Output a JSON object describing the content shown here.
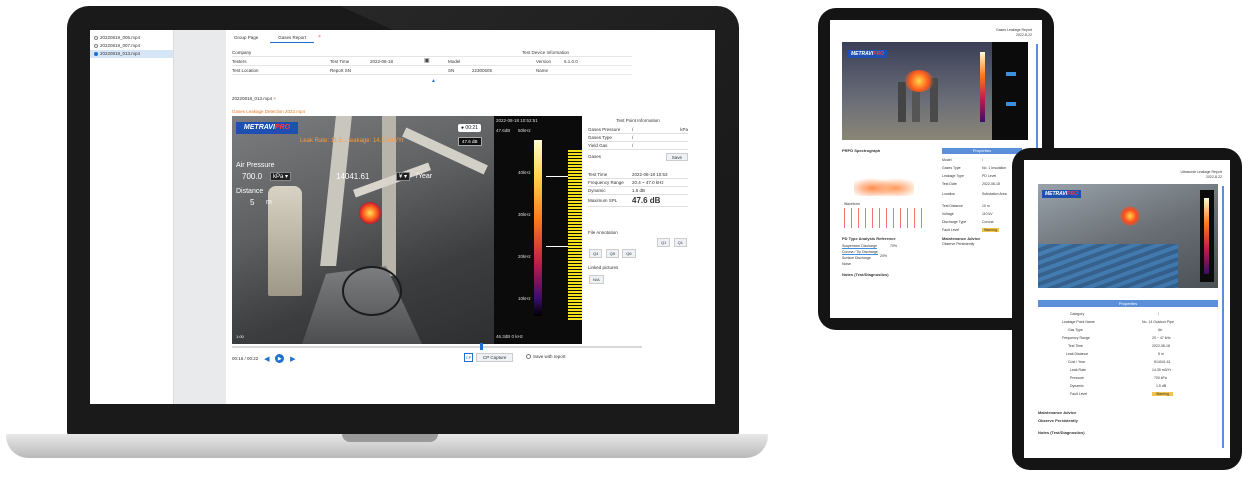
{
  "laptop": {
    "files": [
      "20220818_006.mp4",
      "20220818_007.mp4",
      "20220818_013.mp4"
    ],
    "tabs": {
      "group_page": "Group Page",
      "gases_report": "Gases Report",
      "close": "×"
    },
    "info": {
      "company": "Company",
      "test_device_info": "Test Device Information",
      "testers": "Testers",
      "test_time_label": "Test Time",
      "test_time": "2022-08-18",
      "model": "Model",
      "version_label": "Version",
      "version": "5.1.0.0",
      "test_location": "Test Location",
      "report_sn": "Report SN",
      "sn_label": "SN",
      "sn": "22300505",
      "name_label": "Name"
    },
    "file_title": "20220818_013.mp4",
    "file_subtitle": "Gases Leakage Detection 2022.mp4",
    "video": {
      "logo_main": "METRAVI",
      "logo_pro": "PRO",
      "orange_line": "Leak Rate: 11.5... leakage: 14.39m3/Yr",
      "air_pressure_label": "Air Pressure",
      "air_pressure_value": "700.0",
      "pressure_unit": "kPa ▾",
      "cost_value": "14041.61",
      "currency": "¥ ▾",
      "per_year": "/Year",
      "distance_label": "Distance",
      "distance_value": "5",
      "distance_unit": "m",
      "corner_label": "● 00:21",
      "db_label": "47.6 dB",
      "spectro_top": "2022-08-18 10:52:51",
      "spectro_db": "47.6dB",
      "freq_labels": [
        "50kHz",
        "40kHz",
        "30kHz",
        "20kHz",
        "10kHz"
      ],
      "spectro_bottom": "46.3dB  0  kHz",
      "grid_label": "1:00"
    },
    "controls": {
      "time": "00:16 / 00:22",
      "prev": "◀",
      "play": "▶",
      "next": "▶",
      "cp_icon": "CP",
      "cp_label": "CP Capture",
      "save_label": "Save with report"
    },
    "panel": {
      "header": "Test Point Information",
      "gases_pressure_label": "Gases Pressure",
      "gases_pressure_value": "/",
      "gases_pressure_unit": "kPa",
      "gases_type_label": "Gases Type",
      "gases_type_value": "/",
      "yield_gas_label": "Yield Gas",
      "yield_gas_value": "/",
      "gases_label": "Gases",
      "save_btn": "Save",
      "test_time_label": "Test Time",
      "test_time_value": "2022-08-18 10:53",
      "freq_range_label": "Frequency Range",
      "freq_range_value": "20.4 ~ 47.0 kHz",
      "dynamic_label": "Dynamic",
      "dynamic_value": "1.5 dB",
      "max_label": "Maximum SPL",
      "max_value": "47.6 dB",
      "file_annotation": "File Annotation",
      "annot_buttons": [
        "Q1",
        "Q1",
        "Q4",
        "Q5",
        "Q6"
      ],
      "linked_pictures": "Linked pictures",
      "add_label": "N/A"
    }
  },
  "tablet_left": {
    "header_title": "Gases Leakage Report",
    "header_date": "2022-8-22",
    "logo_main": "METRAVI",
    "logo_pro": "PRO",
    "section_prps": "PRPD Spectrograph",
    "section_properties": "Properties",
    "waveform": "Waveform",
    "pd_type": "PD Type Analysis Reference",
    "pd_rows": [
      "Suspension Discharge",
      "Corona / Tip Discharge",
      "Surface Discharge",
      "Noise"
    ],
    "pd_pct": [
      "70%",
      "20%"
    ],
    "maintenance": "Maintenance Advice",
    "observe": "Observe Persistently",
    "notes": "Notes (Test/Diagnostics)",
    "prop_labels": [
      "Model",
      "Gases Type",
      "Leakage Type",
      "Test Date",
      "Location",
      "Test Distance",
      "Voltage",
      "Discharge Type",
      "Fault Level"
    ],
    "prop_values": [
      "/",
      "No. 1 Insulation",
      "PD Level",
      "2022-08-18",
      "Substation Area",
      "10 m",
      "110 kV",
      "Corona",
      "Warning"
    ]
  },
  "tablet_right": {
    "header_title": "Ultrasonic Leakage Report",
    "header_date": "2022-8-22",
    "logo_main": "METRAVI",
    "logo_pro": "PRO",
    "properties": "Properties",
    "prop_labels": [
      "Category",
      "Leakage Point Name",
      "Gas Type",
      "Frequency Range",
      "Test Time",
      "Leak Distance",
      "Cost / Year",
      "Leak Rate",
      "Pressure",
      "Dynamic",
      "Fault Level"
    ],
    "prop_values": [
      "/",
      "No. 14 Outdoor Pipe",
      "Air",
      "20 ~ 47 kHz",
      "2022-08-18",
      "5 m",
      "¥14041.61",
      "14.39 m3/Yr",
      "700 kPa",
      "1.5 dB",
      "Warning"
    ],
    "maintenance": "Maintenance Advice",
    "observe": "Observe Persistently",
    "notes": "Notes (Test/Diagnostics)"
  },
  "colors": {
    "accent": "#1f6fd1",
    "bezel": "#141414",
    "report_bar": "#5b8fd9",
    "orange": "#e07a22"
  }
}
